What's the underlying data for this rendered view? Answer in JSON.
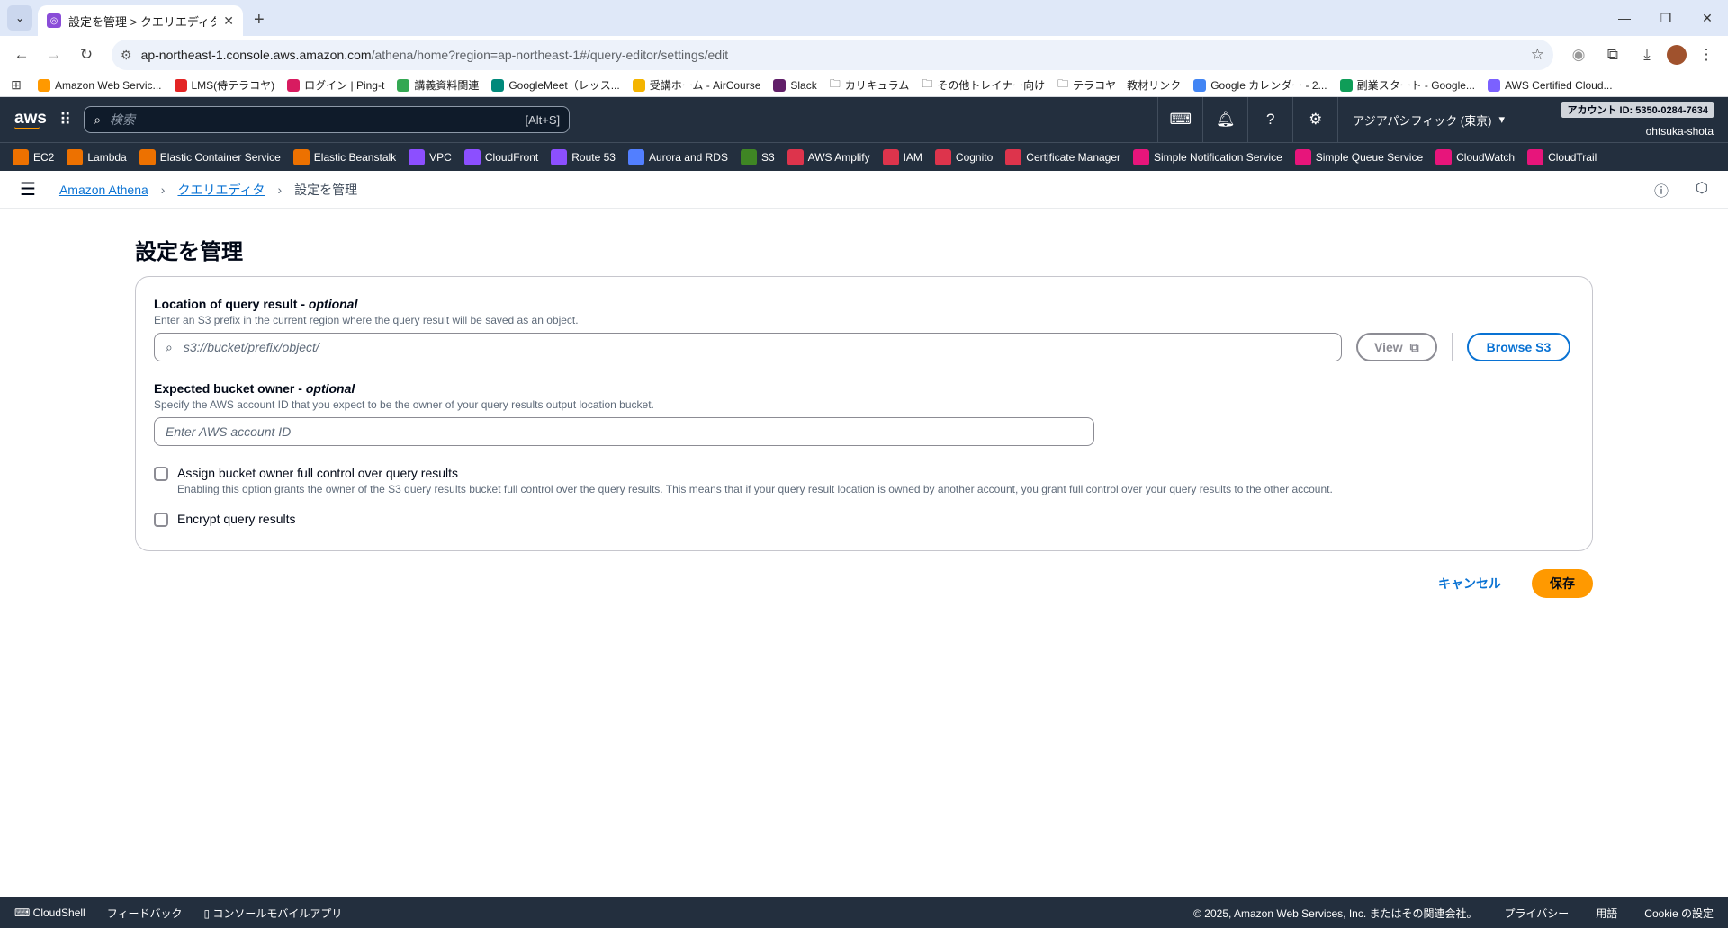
{
  "browser": {
    "tab_title": "設定を管理 > クエリエディタ | Athe",
    "url_host": "ap-northeast-1.console.aws.amazon.com",
    "url_path": "/athena/home?region=ap-northeast-1#/query-editor/settings/edit",
    "bookmarks": [
      {
        "label": "Amazon Web Servic...",
        "color": "#ff9900"
      },
      {
        "label": "LMS(侍テラコヤ)",
        "color": "#e32424"
      },
      {
        "label": "ログイン | Ping-t",
        "color": "#d81b60"
      },
      {
        "label": "講義資料関連",
        "color": "#34a853"
      },
      {
        "label": "GoogleMeet（レッス...",
        "color": "#00897b"
      },
      {
        "label": "受講ホーム - AirCourse",
        "color": "#f4b400"
      },
      {
        "label": "Slack",
        "color": "#611f69"
      },
      {
        "label": "カリキュラム",
        "color": "#5f6368"
      },
      {
        "label": "その他トレイナー向け",
        "color": "#5f6368"
      },
      {
        "label": "テラコヤ　教材リンク",
        "color": "#5f6368"
      },
      {
        "label": "Google カレンダー - 2...",
        "color": "#4285f4"
      },
      {
        "label": "副業スタート - Google...",
        "color": "#0f9d58"
      },
      {
        "label": "AWS Certified Cloud...",
        "color": "#7b61ff"
      }
    ]
  },
  "aws": {
    "logo": "aws",
    "search_placeholder": "検索",
    "search_shortcut": "[Alt+S]",
    "region": "アジアパシフィック (東京)",
    "account_id": "アカウント ID: 5350-0284-7634",
    "user": "ohtsuka-shota",
    "services": [
      {
        "label": "EC2",
        "color": "#ed7100"
      },
      {
        "label": "Lambda",
        "color": "#ed7100"
      },
      {
        "label": "Elastic Container Service",
        "color": "#ed7100"
      },
      {
        "label": "Elastic Beanstalk",
        "color": "#ed7100"
      },
      {
        "label": "VPC",
        "color": "#8c4fff"
      },
      {
        "label": "CloudFront",
        "color": "#8c4fff"
      },
      {
        "label": "Route 53",
        "color": "#8c4fff"
      },
      {
        "label": "Aurora and RDS",
        "color": "#527fff"
      },
      {
        "label": "S3",
        "color": "#3f8624"
      },
      {
        "label": "AWS Amplify",
        "color": "#dd344c"
      },
      {
        "label": "IAM",
        "color": "#dd344c"
      },
      {
        "label": "Cognito",
        "color": "#dd344c"
      },
      {
        "label": "Certificate Manager",
        "color": "#dd344c"
      },
      {
        "label": "Simple Notification Service",
        "color": "#e7157b"
      },
      {
        "label": "Simple Queue Service",
        "color": "#e7157b"
      },
      {
        "label": "CloudWatch",
        "color": "#e7157b"
      },
      {
        "label": "CloudTrail",
        "color": "#e7157b"
      }
    ]
  },
  "breadcrumb": {
    "items": [
      "Amazon Athena",
      "クエリエディタ"
    ],
    "current": "設定を管理"
  },
  "page": {
    "title": "設定を管理",
    "query_result": {
      "label": "Location of query result",
      "optional": "optional",
      "description": "Enter an S3 prefix in the current region where the query result will be saved as an object.",
      "placeholder": "s3://bucket/prefix/object/",
      "view_button": "View",
      "browse_button": "Browse S3"
    },
    "bucket_owner": {
      "label": "Expected bucket owner",
      "optional": "optional",
      "description": "Specify the AWS account ID that you expect to be the owner of your query results output location bucket.",
      "placeholder": "Enter AWS account ID"
    },
    "assign_control": {
      "label": "Assign bucket owner full control over query results",
      "description": "Enabling this option grants the owner of the S3 query results bucket full control over the query results. This means that if your query result location is owned by another account, you grant full control over your query results to the other account.",
      "checked": false
    },
    "encrypt": {
      "label": "Encrypt query results",
      "checked": false
    },
    "cancel_button": "キャンセル",
    "save_button": "保存"
  },
  "footer": {
    "cloudshell": "CloudShell",
    "feedback": "フィードバック",
    "mobile_app": "コンソールモバイルアプリ",
    "copyright": "© 2025, Amazon Web Services, Inc. またはその関連会社。",
    "privacy": "プライバシー",
    "terms": "用語",
    "cookie": "Cookie の設定"
  }
}
